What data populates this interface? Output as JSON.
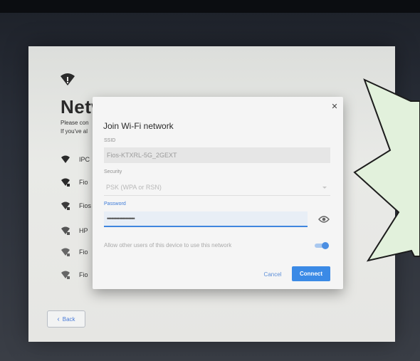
{
  "screen": {
    "title": "Netw",
    "intro_lines": [
      "Please con",
      "If you've al"
    ]
  },
  "networks": [
    {
      "name": "IPC",
      "secured": false
    },
    {
      "name": "Fio",
      "secured": true
    },
    {
      "name": "Fios",
      "secured": true
    },
    {
      "name": "HP",
      "secured": true
    },
    {
      "name": "Fio",
      "secured": true
    },
    {
      "name": "Fio",
      "secured": true
    }
  ],
  "footer": {
    "back_label": "Back"
  },
  "dialog": {
    "title": "Join Wi-Fi network",
    "ssid_label": "SSID",
    "ssid_value": "Fios-KTXRL-5G_2GEXT",
    "security_label": "Security",
    "security_value": "PSK (WPA or RSN)",
    "password_label": "Password",
    "password_value": "••••••••••••••••••",
    "share_label": "Allow other users of this device to use this network",
    "share_enabled": true,
    "cancel_label": "Cancel",
    "connect_label": "Connect"
  },
  "colors": {
    "accent": "#3b8ae6",
    "annotation_fill": "#e2f1dc"
  }
}
